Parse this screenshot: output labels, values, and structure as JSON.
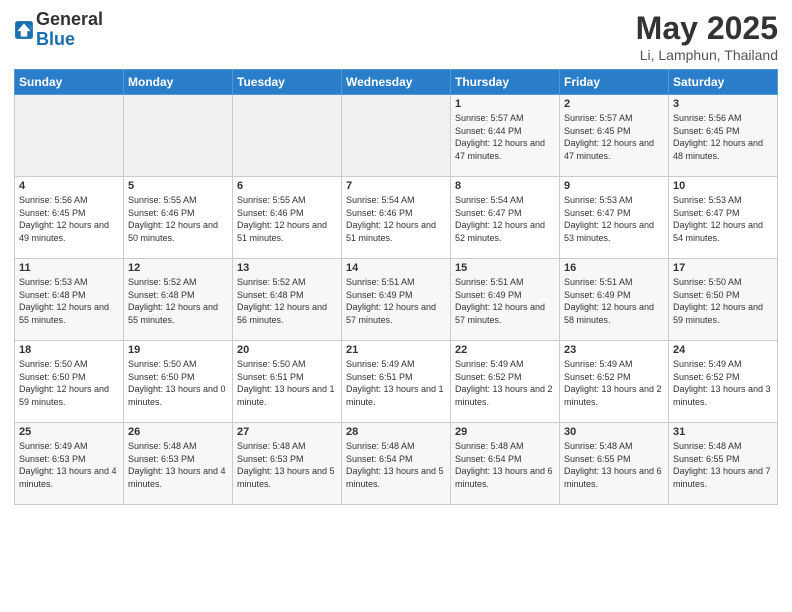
{
  "logo": {
    "general": "General",
    "blue": "Blue"
  },
  "title": {
    "month": "May 2025",
    "location": "Li, Lamphun, Thailand"
  },
  "headers": [
    "Sunday",
    "Monday",
    "Tuesday",
    "Wednesday",
    "Thursday",
    "Friday",
    "Saturday"
  ],
  "weeks": [
    [
      {
        "day": "",
        "info": ""
      },
      {
        "day": "",
        "info": ""
      },
      {
        "day": "",
        "info": ""
      },
      {
        "day": "",
        "info": ""
      },
      {
        "day": "1",
        "info": "Sunrise: 5:57 AM\nSunset: 6:44 PM\nDaylight: 12 hours\nand 47 minutes."
      },
      {
        "day": "2",
        "info": "Sunrise: 5:57 AM\nSunset: 6:45 PM\nDaylight: 12 hours\nand 47 minutes."
      },
      {
        "day": "3",
        "info": "Sunrise: 5:56 AM\nSunset: 6:45 PM\nDaylight: 12 hours\nand 48 minutes."
      }
    ],
    [
      {
        "day": "4",
        "info": "Sunrise: 5:56 AM\nSunset: 6:45 PM\nDaylight: 12 hours\nand 49 minutes."
      },
      {
        "day": "5",
        "info": "Sunrise: 5:55 AM\nSunset: 6:46 PM\nDaylight: 12 hours\nand 50 minutes."
      },
      {
        "day": "6",
        "info": "Sunrise: 5:55 AM\nSunset: 6:46 PM\nDaylight: 12 hours\nand 51 minutes."
      },
      {
        "day": "7",
        "info": "Sunrise: 5:54 AM\nSunset: 6:46 PM\nDaylight: 12 hours\nand 51 minutes."
      },
      {
        "day": "8",
        "info": "Sunrise: 5:54 AM\nSunset: 6:47 PM\nDaylight: 12 hours\nand 52 minutes."
      },
      {
        "day": "9",
        "info": "Sunrise: 5:53 AM\nSunset: 6:47 PM\nDaylight: 12 hours\nand 53 minutes."
      },
      {
        "day": "10",
        "info": "Sunrise: 5:53 AM\nSunset: 6:47 PM\nDaylight: 12 hours\nand 54 minutes."
      }
    ],
    [
      {
        "day": "11",
        "info": "Sunrise: 5:53 AM\nSunset: 6:48 PM\nDaylight: 12 hours\nand 55 minutes."
      },
      {
        "day": "12",
        "info": "Sunrise: 5:52 AM\nSunset: 6:48 PM\nDaylight: 12 hours\nand 55 minutes."
      },
      {
        "day": "13",
        "info": "Sunrise: 5:52 AM\nSunset: 6:48 PM\nDaylight: 12 hours\nand 56 minutes."
      },
      {
        "day": "14",
        "info": "Sunrise: 5:51 AM\nSunset: 6:49 PM\nDaylight: 12 hours\nand 57 minutes."
      },
      {
        "day": "15",
        "info": "Sunrise: 5:51 AM\nSunset: 6:49 PM\nDaylight: 12 hours\nand 57 minutes."
      },
      {
        "day": "16",
        "info": "Sunrise: 5:51 AM\nSunset: 6:49 PM\nDaylight: 12 hours\nand 58 minutes."
      },
      {
        "day": "17",
        "info": "Sunrise: 5:50 AM\nSunset: 6:50 PM\nDaylight: 12 hours\nand 59 minutes."
      }
    ],
    [
      {
        "day": "18",
        "info": "Sunrise: 5:50 AM\nSunset: 6:50 PM\nDaylight: 12 hours\nand 59 minutes."
      },
      {
        "day": "19",
        "info": "Sunrise: 5:50 AM\nSunset: 6:50 PM\nDaylight: 13 hours\nand 0 minutes."
      },
      {
        "day": "20",
        "info": "Sunrise: 5:50 AM\nSunset: 6:51 PM\nDaylight: 13 hours\nand 1 minute."
      },
      {
        "day": "21",
        "info": "Sunrise: 5:49 AM\nSunset: 6:51 PM\nDaylight: 13 hours\nand 1 minute."
      },
      {
        "day": "22",
        "info": "Sunrise: 5:49 AM\nSunset: 6:52 PM\nDaylight: 13 hours\nand 2 minutes."
      },
      {
        "day": "23",
        "info": "Sunrise: 5:49 AM\nSunset: 6:52 PM\nDaylight: 13 hours\nand 2 minutes."
      },
      {
        "day": "24",
        "info": "Sunrise: 5:49 AM\nSunset: 6:52 PM\nDaylight: 13 hours\nand 3 minutes."
      }
    ],
    [
      {
        "day": "25",
        "info": "Sunrise: 5:49 AM\nSunset: 6:53 PM\nDaylight: 13 hours\nand 4 minutes."
      },
      {
        "day": "26",
        "info": "Sunrise: 5:48 AM\nSunset: 6:53 PM\nDaylight: 13 hours\nand 4 minutes."
      },
      {
        "day": "27",
        "info": "Sunrise: 5:48 AM\nSunset: 6:53 PM\nDaylight: 13 hours\nand 5 minutes."
      },
      {
        "day": "28",
        "info": "Sunrise: 5:48 AM\nSunset: 6:54 PM\nDaylight: 13 hours\nand 5 minutes."
      },
      {
        "day": "29",
        "info": "Sunrise: 5:48 AM\nSunset: 6:54 PM\nDaylight: 13 hours\nand 6 minutes."
      },
      {
        "day": "30",
        "info": "Sunrise: 5:48 AM\nSunset: 6:55 PM\nDaylight: 13 hours\nand 6 minutes."
      },
      {
        "day": "31",
        "info": "Sunrise: 5:48 AM\nSunset: 6:55 PM\nDaylight: 13 hours\nand 7 minutes."
      }
    ]
  ]
}
